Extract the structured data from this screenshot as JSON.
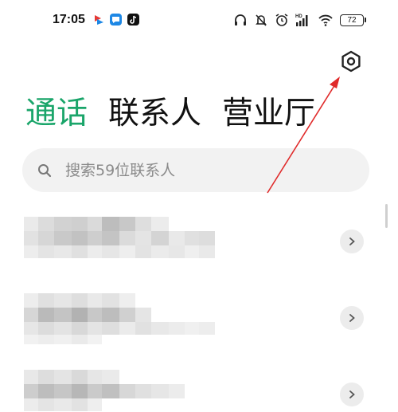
{
  "status_bar": {
    "time": "17:05",
    "battery": "72",
    "icons": [
      "headset-icon",
      "mute-icon",
      "alarm-icon",
      "hd-signal-icon",
      "wifi-icon",
      "battery-icon"
    ]
  },
  "tabs": [
    {
      "label": "通话",
      "active": true
    },
    {
      "label": "联系人",
      "active": false
    },
    {
      "label": "营业厅",
      "active": false
    }
  ],
  "search": {
    "placeholder": "搜索59位联系人"
  },
  "colors": {
    "accent": "#1aa56a",
    "annotation": "#e02a2a"
  },
  "list": {
    "item_count": 3,
    "content_blurred": true
  }
}
